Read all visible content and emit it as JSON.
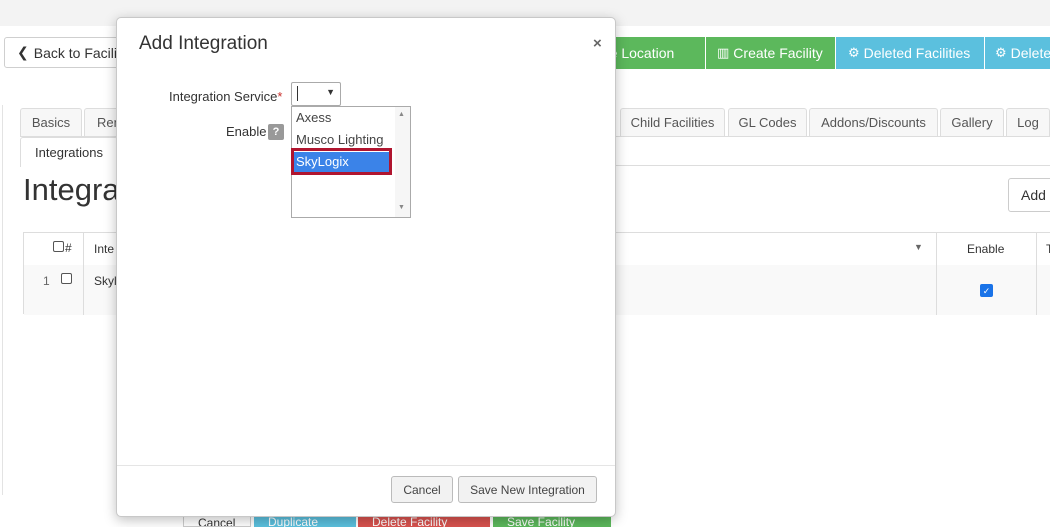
{
  "toolbar": {
    "back_label": "Back to Facilit",
    "create_location_label": "ate Location",
    "create_facility_label": "Create Facility",
    "deleted_facilities_label": "Deleted Facilities",
    "deleted_other_label": "Delete"
  },
  "tabs": {
    "row1": [
      "Basics",
      "Ren",
      "Child Facilities",
      "GL Codes",
      "Addons/Discounts",
      "Gallery",
      "Log"
    ],
    "row2": [
      "Integrations"
    ]
  },
  "page": {
    "title": "Integra",
    "add_label": "Add"
  },
  "grid": {
    "headers": {
      "number": "#",
      "name": "Inte",
      "enable": "Enable",
      "extra": "T"
    },
    "rows": [
      {
        "number": "1",
        "name": "Skyl",
        "enabled": true
      }
    ]
  },
  "bottom_bar": {
    "buttons": [
      "Cancel",
      "Duplicate",
      "Delete Facility",
      "Save Facility"
    ]
  },
  "modal": {
    "title": "Add Integration",
    "close_symbol": "×",
    "service_label": "Integration Service",
    "required_marker": "*",
    "enable_label": "Enable",
    "help_symbol": "?",
    "options": [
      "Axess",
      "Musco Lighting",
      "SkyLogix"
    ],
    "highlighted_option": "SkyLogix",
    "cancel_label": "Cancel",
    "save_label": "Save New Integration"
  },
  "colors": {
    "green": "#5cb85c",
    "info": "#5bc0de",
    "selection": "#3b83e8",
    "highlight_outline": "#b0152f"
  }
}
